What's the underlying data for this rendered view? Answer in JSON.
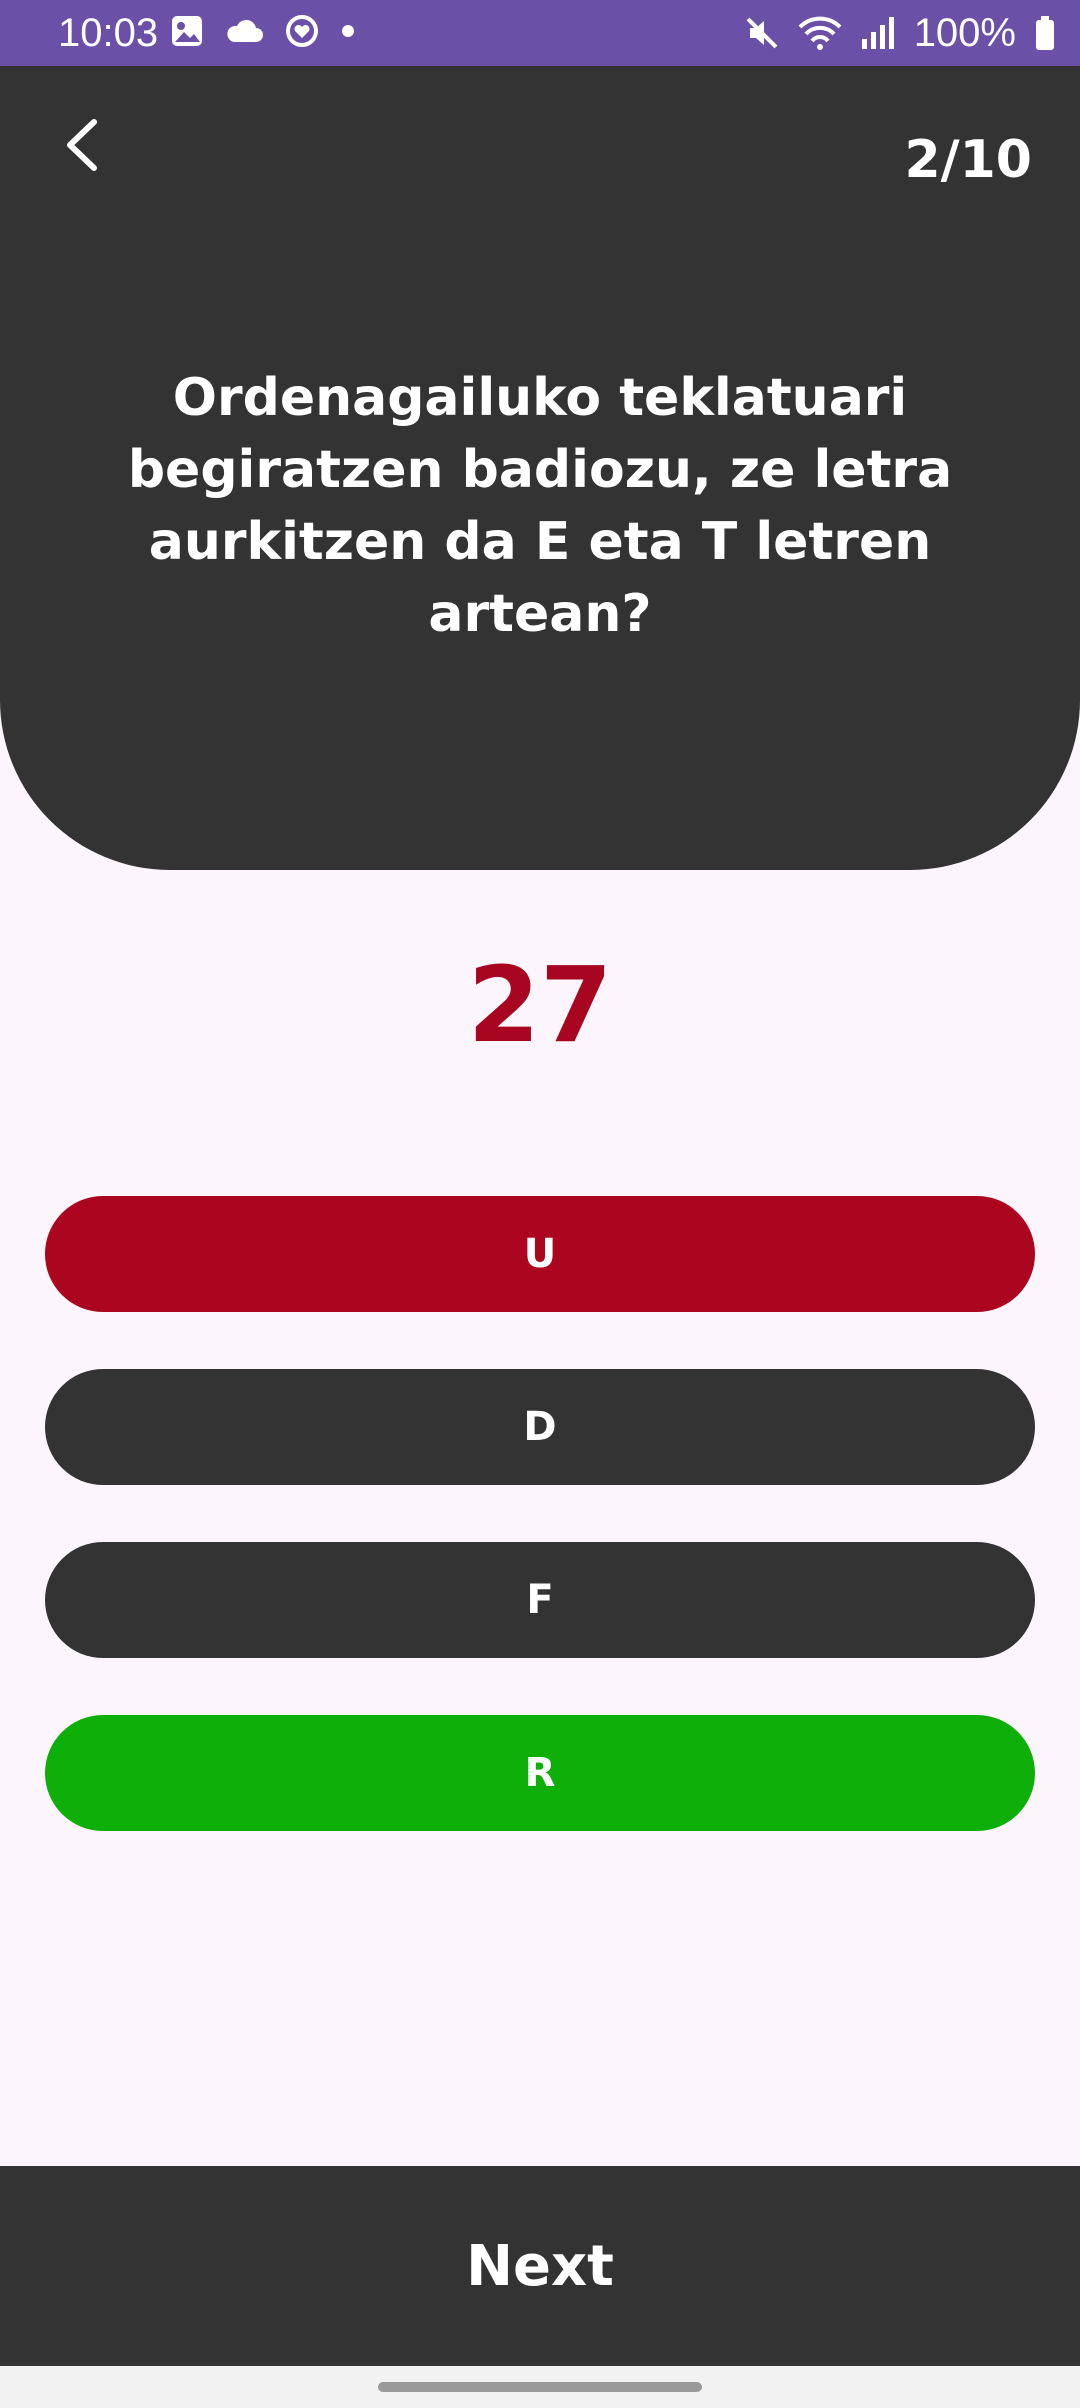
{
  "status_bar": {
    "time": "10:03",
    "left_icons": [
      "image-icon",
      "cloud-icon",
      "sync-heart-icon",
      "dot-icon"
    ],
    "right_icons": [
      "mute-icon",
      "wifi-icon",
      "signal-icon",
      "battery-icon"
    ],
    "battery": "100%"
  },
  "quiz": {
    "progress": "2/10",
    "question": "Ordenagailuko teklatuari begiratzen badiozu, ze letra aurkitzen da E eta T letren artean?",
    "timer": "27",
    "answers": [
      {
        "label": "U",
        "state": "wrong",
        "color": "#ab0520"
      },
      {
        "label": "D",
        "state": "neutral",
        "color": "#333333"
      },
      {
        "label": "F",
        "state": "neutral",
        "color": "#333333"
      },
      {
        "label": "R",
        "state": "correct",
        "color": "#0faf0a"
      }
    ]
  },
  "footer": {
    "next_label": "Next"
  },
  "colors": {
    "status_bar": "#6a50a7",
    "dark": "#333333",
    "background": "#fcf6fc",
    "timer": "#a80620",
    "wrong": "#ab0520",
    "correct": "#0faf0a"
  }
}
